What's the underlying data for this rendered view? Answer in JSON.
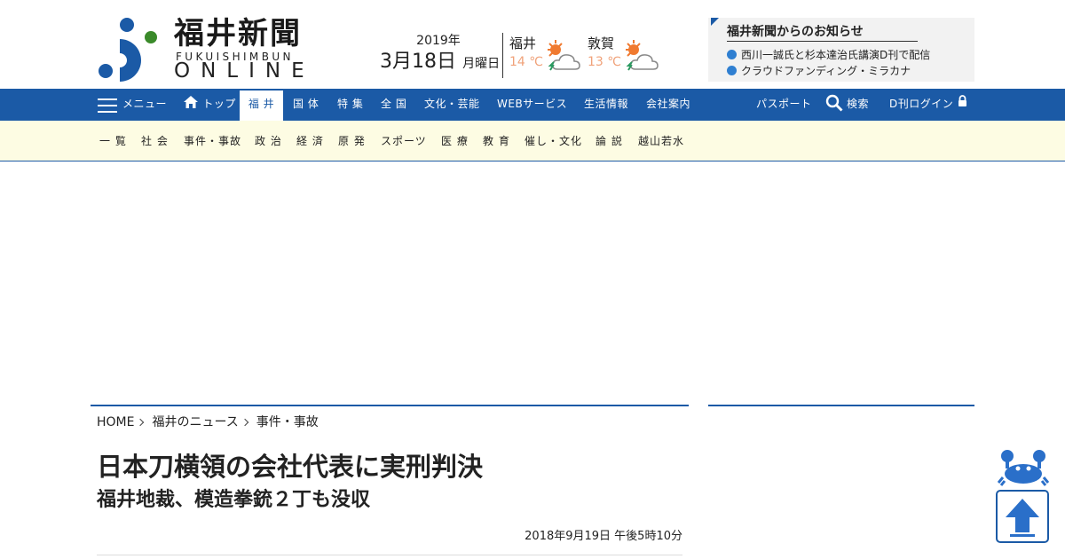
{
  "header": {
    "logo": {
      "title": "福井新聞",
      "sub": "FUKUISHIMBUN",
      "online": "ONLINE"
    },
    "date": {
      "year": "2019年",
      "day": "3月18日",
      "weekday": "月曜日"
    },
    "weather": [
      {
        "city": "福井",
        "temp": "14 ℃",
        "icon": "sun-cloud-rain-icon"
      },
      {
        "city": "敦賀",
        "temp": "13 ℃",
        "icon": "sun-cloud-rain-icon"
      }
    ],
    "notice": {
      "title": "福井新聞からのお知らせ",
      "items": [
        "西川一誠氏と杉本達治氏講演D刊で配信",
        "クラウドファンディング・ミラカナ"
      ]
    }
  },
  "mainnav": {
    "menu": "メニュー",
    "items": [
      "トップ",
      "福 井",
      "国 体",
      "特 集",
      "全 国",
      "文化・芸能",
      "WEBサービス",
      "生活情報",
      "会社案内"
    ],
    "active": "福 井",
    "passport": "パスポート",
    "search": "検索",
    "login": "D刊ログイン"
  },
  "subnav": {
    "items": [
      "一 覧",
      "社 会",
      "事件・事故",
      "政 治",
      "経 済",
      "原 発",
      "スポーツ",
      "医 療",
      "教 育",
      "催し・文化",
      "論 説",
      "越山若水"
    ]
  },
  "article": {
    "breadcrumb": [
      "HOME",
      "福井のニュース",
      "事件・事故"
    ],
    "headline": "日本刀横領の会社代表に実刑判決",
    "subheadline": "福井地裁、模造拳銃２丁も没収",
    "timestamp": "2018年9月19日 午後5時10分"
  },
  "colors": {
    "brand": "#1b5aa6",
    "subnav_bg": "#fdfce3",
    "temp": "#f0a27a",
    "logo_green": "#3a8a2a"
  }
}
